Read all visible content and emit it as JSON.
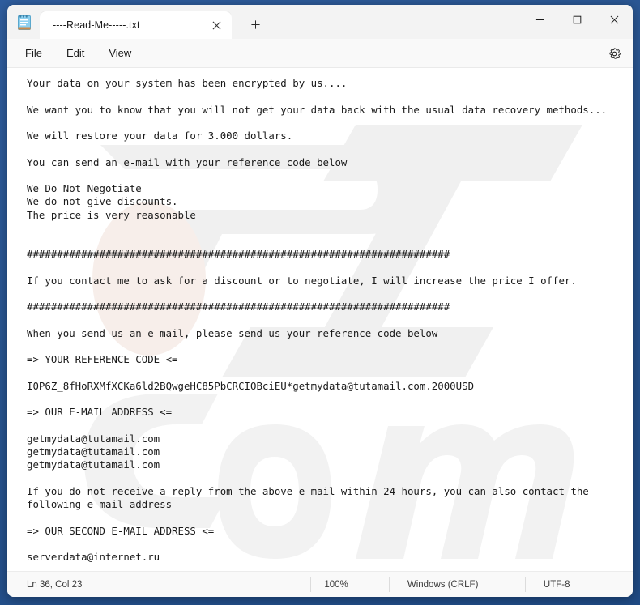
{
  "window": {
    "app_icon": "notepad-icon",
    "tab_title": "----Read-Me-----.txt",
    "close_tab_icon": "close-icon",
    "new_tab_icon": "plus-icon",
    "minimize_icon": "minimize-icon",
    "maximize_icon": "maximize-icon",
    "close_icon": "close-icon"
  },
  "menu": {
    "items": [
      {
        "label": "File"
      },
      {
        "label": "Edit"
      },
      {
        "label": "View"
      }
    ],
    "settings_icon": "gear-icon"
  },
  "document": {
    "content": "Your data on your system has been encrypted by us....\n\nWe want you to know that you will not get your data back with the usual data recovery methods...\n\nWe will restore your data for 3.000 dollars.\n\nYou can send an e-mail with your reference code below\n\nWe Do Not Negotiate\nWe do not give discounts.\nThe price is very reasonable\n\n\n######################################################################\n\nIf you contact me to ask for a discount or to negotiate, I will increase the price I offer.\n\n######################################################################\n\nWhen you send us an e-mail, please send us your reference code below\n\n=> YOUR REFERENCE CODE <=\n\nI0P6Z_8fHoRXMfXCKa6ld2BQwgeHC85PbCRCIOBciEU*getmydata@tutamail.com.2000USD\n\n=> OUR E-MAIL ADDRESS <=\n\ngetmydata@tutamail.com\ngetmydata@tutamail.com\ngetmydata@tutamail.com\n\nIf you do not receive a reply from the above e-mail within 24 hours, you can also contact the\nfollowing e-mail address\n\n=> OUR SECOND E-MAIL ADDRESS <=\n\nserverdata@internet.ru"
  },
  "statusbar": {
    "line_col": "Ln 36, Col 23",
    "zoom": "100%",
    "line_endings": "Windows (CRLF)",
    "encoding": "UTF-8"
  },
  "colors": {
    "desktop": "#2b5797",
    "window_chrome": "#f3f3f3",
    "editor_background": "#ffffff",
    "text": "#1a1a1a",
    "accent": "#0067c0"
  }
}
